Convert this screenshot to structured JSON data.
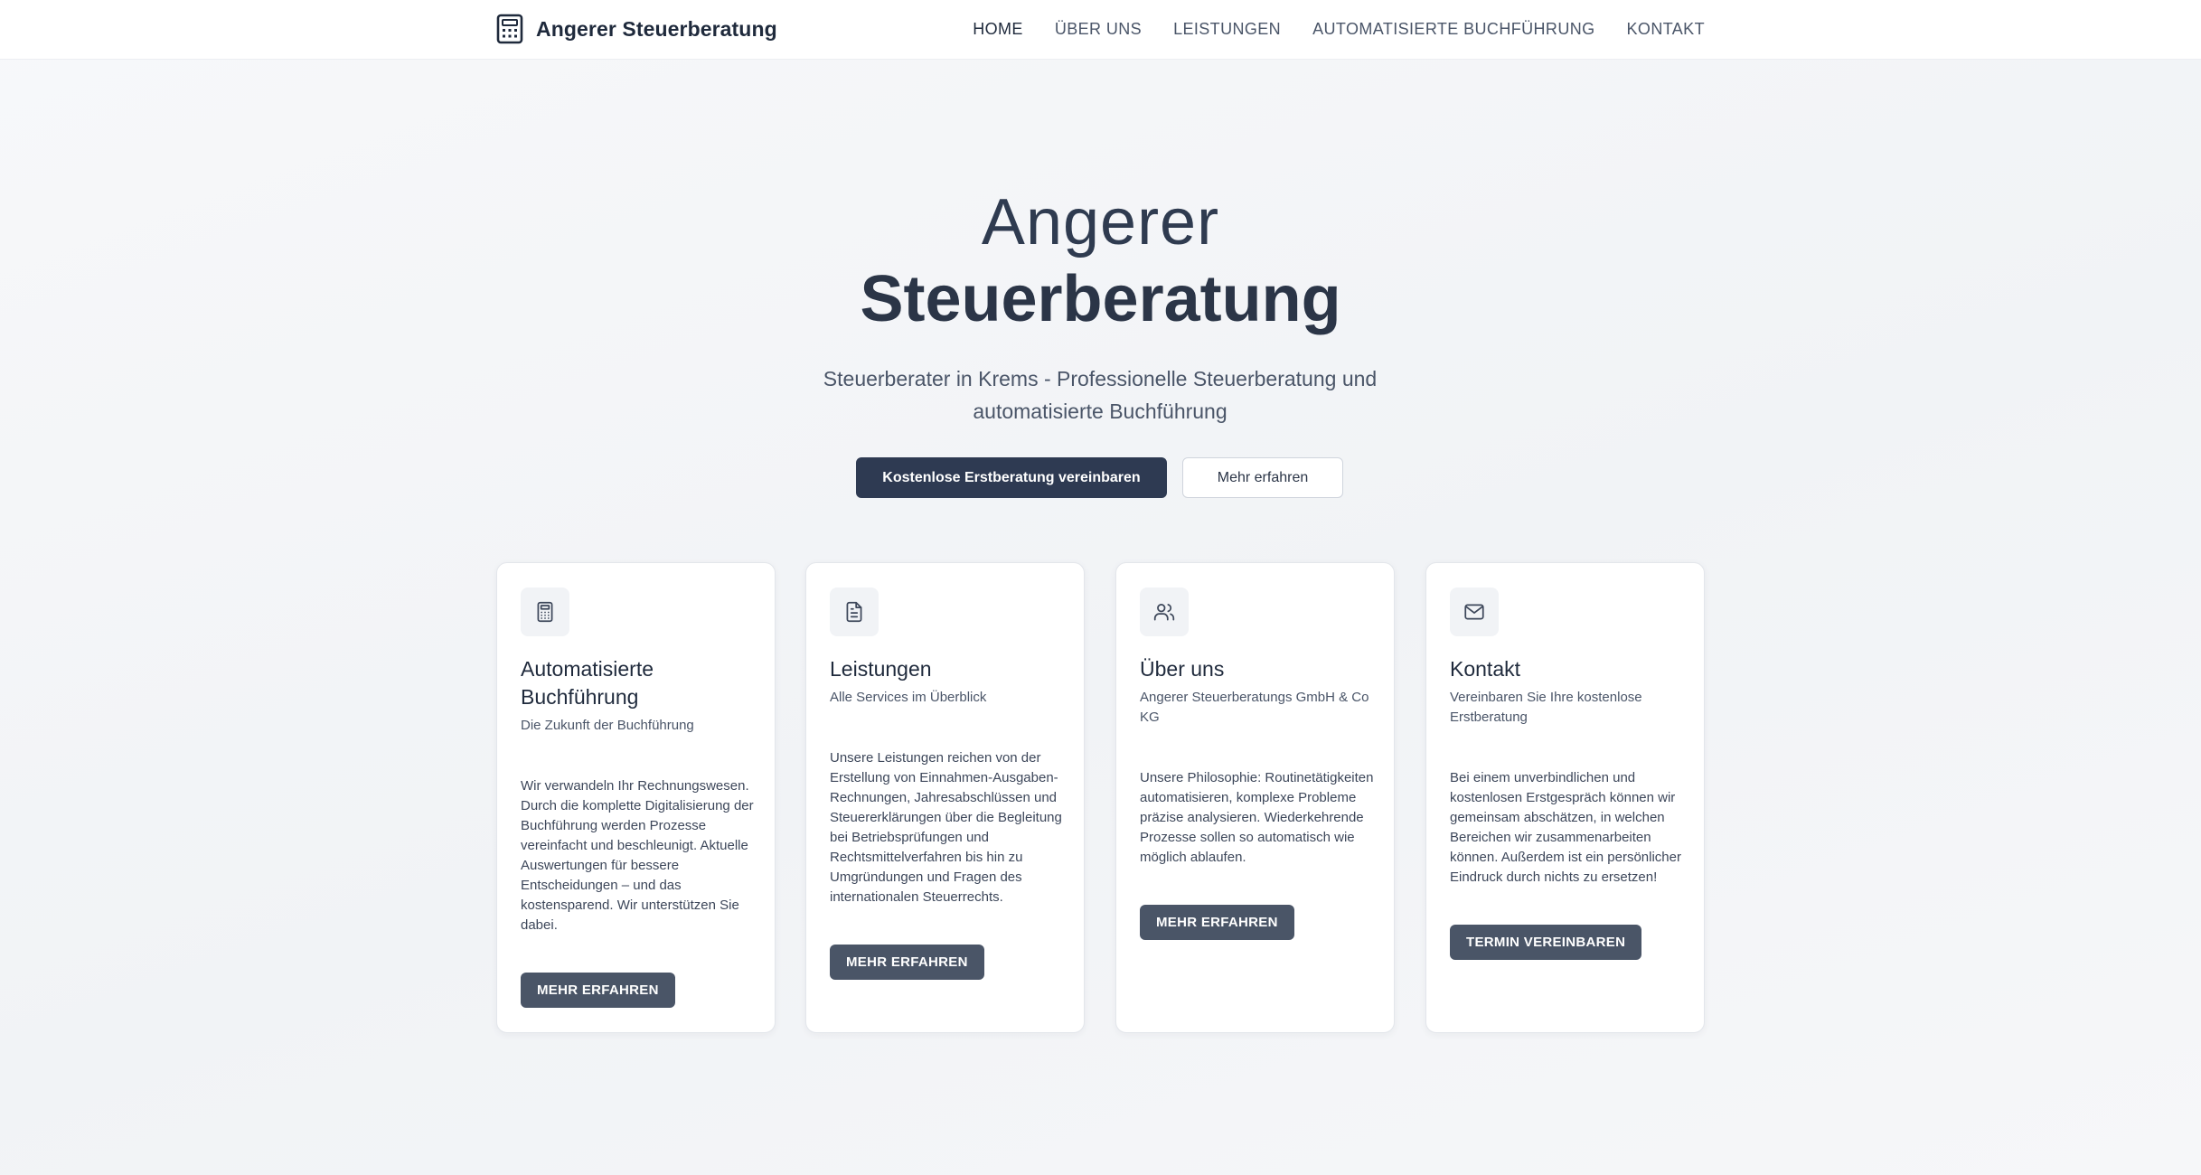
{
  "brand": {
    "name": "Angerer Steuerberatung",
    "icon": "calculator-icon"
  },
  "nav": {
    "items": [
      {
        "label": "HOME",
        "active": true
      },
      {
        "label": "ÜBER UNS",
        "active": false
      },
      {
        "label": "LEISTUNGEN",
        "active": false
      },
      {
        "label": "AUTOMATISIERTE BUCHFÜHRUNG",
        "active": false
      },
      {
        "label": "KONTAKT",
        "active": false
      }
    ]
  },
  "hero": {
    "title_light": "Angerer",
    "title_bold": "Steuerberatung",
    "subtitle": "Steuerberater in Krems - Professionelle Steuerberatung und automatisierte Buchführung",
    "primary_button": "Kostenlose Erstberatung vereinbaren",
    "secondary_button": "Mehr erfahren"
  },
  "cards": [
    {
      "icon": "calculator-icon",
      "title": "Automatisierte Buchführung",
      "subtitle": "Die Zukunft der Buchführung",
      "body": "Wir verwandeln Ihr Rechnungswesen. Durch die komplette Digitalisierung der Buchführung werden Prozesse vereinfacht und beschleunigt. Aktuelle Auswertungen für bessere Entscheidungen – und das kostensparend. Wir unterstützen Sie dabei.",
      "button": "MEHR ERFAHREN"
    },
    {
      "icon": "document-icon",
      "title": "Leistungen",
      "subtitle": "Alle Services im Überblick",
      "body": "Unsere Leistungen reichen von der Erstellung von Einnahmen-Ausgaben-Rechnungen, Jahresabschlüssen und Steuererklärungen über die Begleitung bei Betriebsprüfungen und Rechtsmittelverfahren bis hin zu Umgründungen und Fragen des internationalen Steuerrechts.",
      "button": "MEHR ERFAHREN"
    },
    {
      "icon": "users-icon",
      "title": "Über uns",
      "subtitle": "Angerer Steuerberatungs GmbH & Co KG",
      "body": "Unsere Philosophie: Routinetätigkeiten automatisieren, komplexe Probleme präzise analysieren. Wiederkehrende Prozesse sollen so automatisch wie möglich ablaufen.",
      "button": "MEHR ERFAHREN"
    },
    {
      "icon": "mail-icon",
      "title": "Kontakt",
      "subtitle": "Vereinbaren Sie Ihre kostenlose Erstberatung",
      "body": "Bei einem unverbindlichen und kostenlosen Erstgespräch können wir gemeinsam abschätzen, in welchen Bereichen wir zusammenarbeiten können. Außerdem ist ein persönlicher Eindruck durch nichts zu ersetzen!",
      "button": "TERMIN VEREINBAREN"
    }
  ],
  "colors": {
    "primary": "#2e3a52",
    "card_button": "#4a5567",
    "text_dark": "#1f2a3c"
  }
}
